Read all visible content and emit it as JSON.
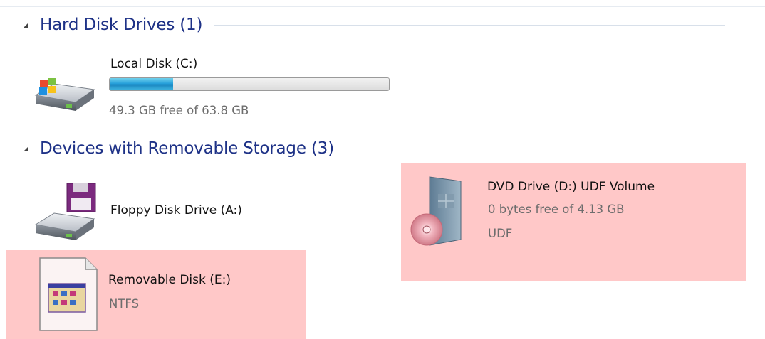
{
  "groups": {
    "hard_disks": {
      "title": "Hard Disk Drives (1)"
    },
    "removable": {
      "title": "Devices with Removable Storage (3)"
    }
  },
  "drives": {
    "local_c": {
      "name": "Local Disk (C:)",
      "free_text": "49.3 GB free of 63.8 GB",
      "used_fraction": 0.227,
      "icon": "hard-drive-icon"
    },
    "floppy_a": {
      "name": "Floppy Disk Drive (A:)",
      "icon": "floppy-drive-icon"
    },
    "removable_e": {
      "name": "Removable Disk (E:)",
      "filesystem": "NTFS",
      "icon": "removable-disk-icon"
    },
    "dvd_d": {
      "name": "DVD Drive (D:) UDF Volume",
      "free_text": "0 bytes free of 4.13 GB",
      "filesystem": "UDF",
      "icon": "dvd-drive-icon"
    }
  },
  "colors": {
    "group_title": "#1e3287",
    "highlight": "#ffc8c8",
    "usage_bar": "#26a0da"
  }
}
